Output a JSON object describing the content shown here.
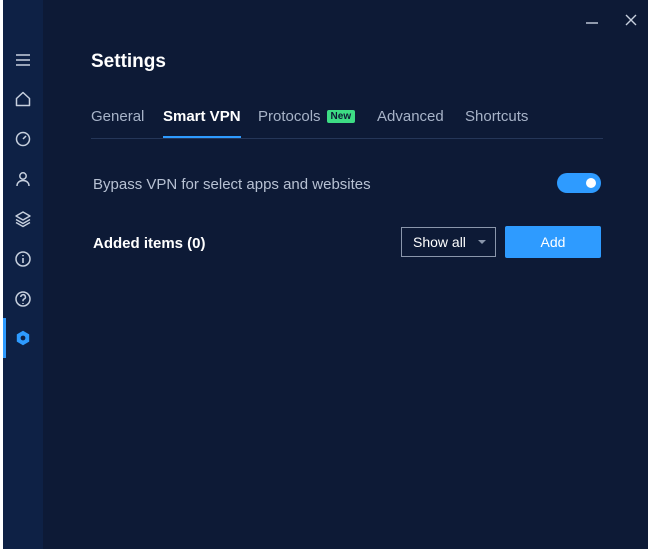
{
  "header": {
    "title": "Settings"
  },
  "tabs": [
    {
      "label": "General"
    },
    {
      "label": "Smart VPN",
      "active": true
    },
    {
      "label": "Protocols",
      "badge": "New"
    },
    {
      "label": "Advanced"
    },
    {
      "label": "Shortcuts"
    }
  ],
  "bypass": {
    "label": "Bypass VPN for select apps and websites",
    "enabled": true
  },
  "added_items": {
    "label": "Added items (0)"
  },
  "filter": {
    "selected": "Show all"
  },
  "add_button": {
    "label": "Add"
  },
  "sidebar": {
    "items": [
      {
        "icon": "menu-icon"
      },
      {
        "icon": "home-icon"
      },
      {
        "icon": "speed-icon"
      },
      {
        "icon": "account-icon"
      },
      {
        "icon": "layers-icon"
      },
      {
        "icon": "info-icon"
      },
      {
        "icon": "help-icon"
      },
      {
        "icon": "settings-icon",
        "active": true
      }
    ]
  },
  "colors": {
    "background": "#0d1a36",
    "sidebar": "#0e2145",
    "accent": "#2e9bff",
    "badge": "#3ddc84"
  }
}
